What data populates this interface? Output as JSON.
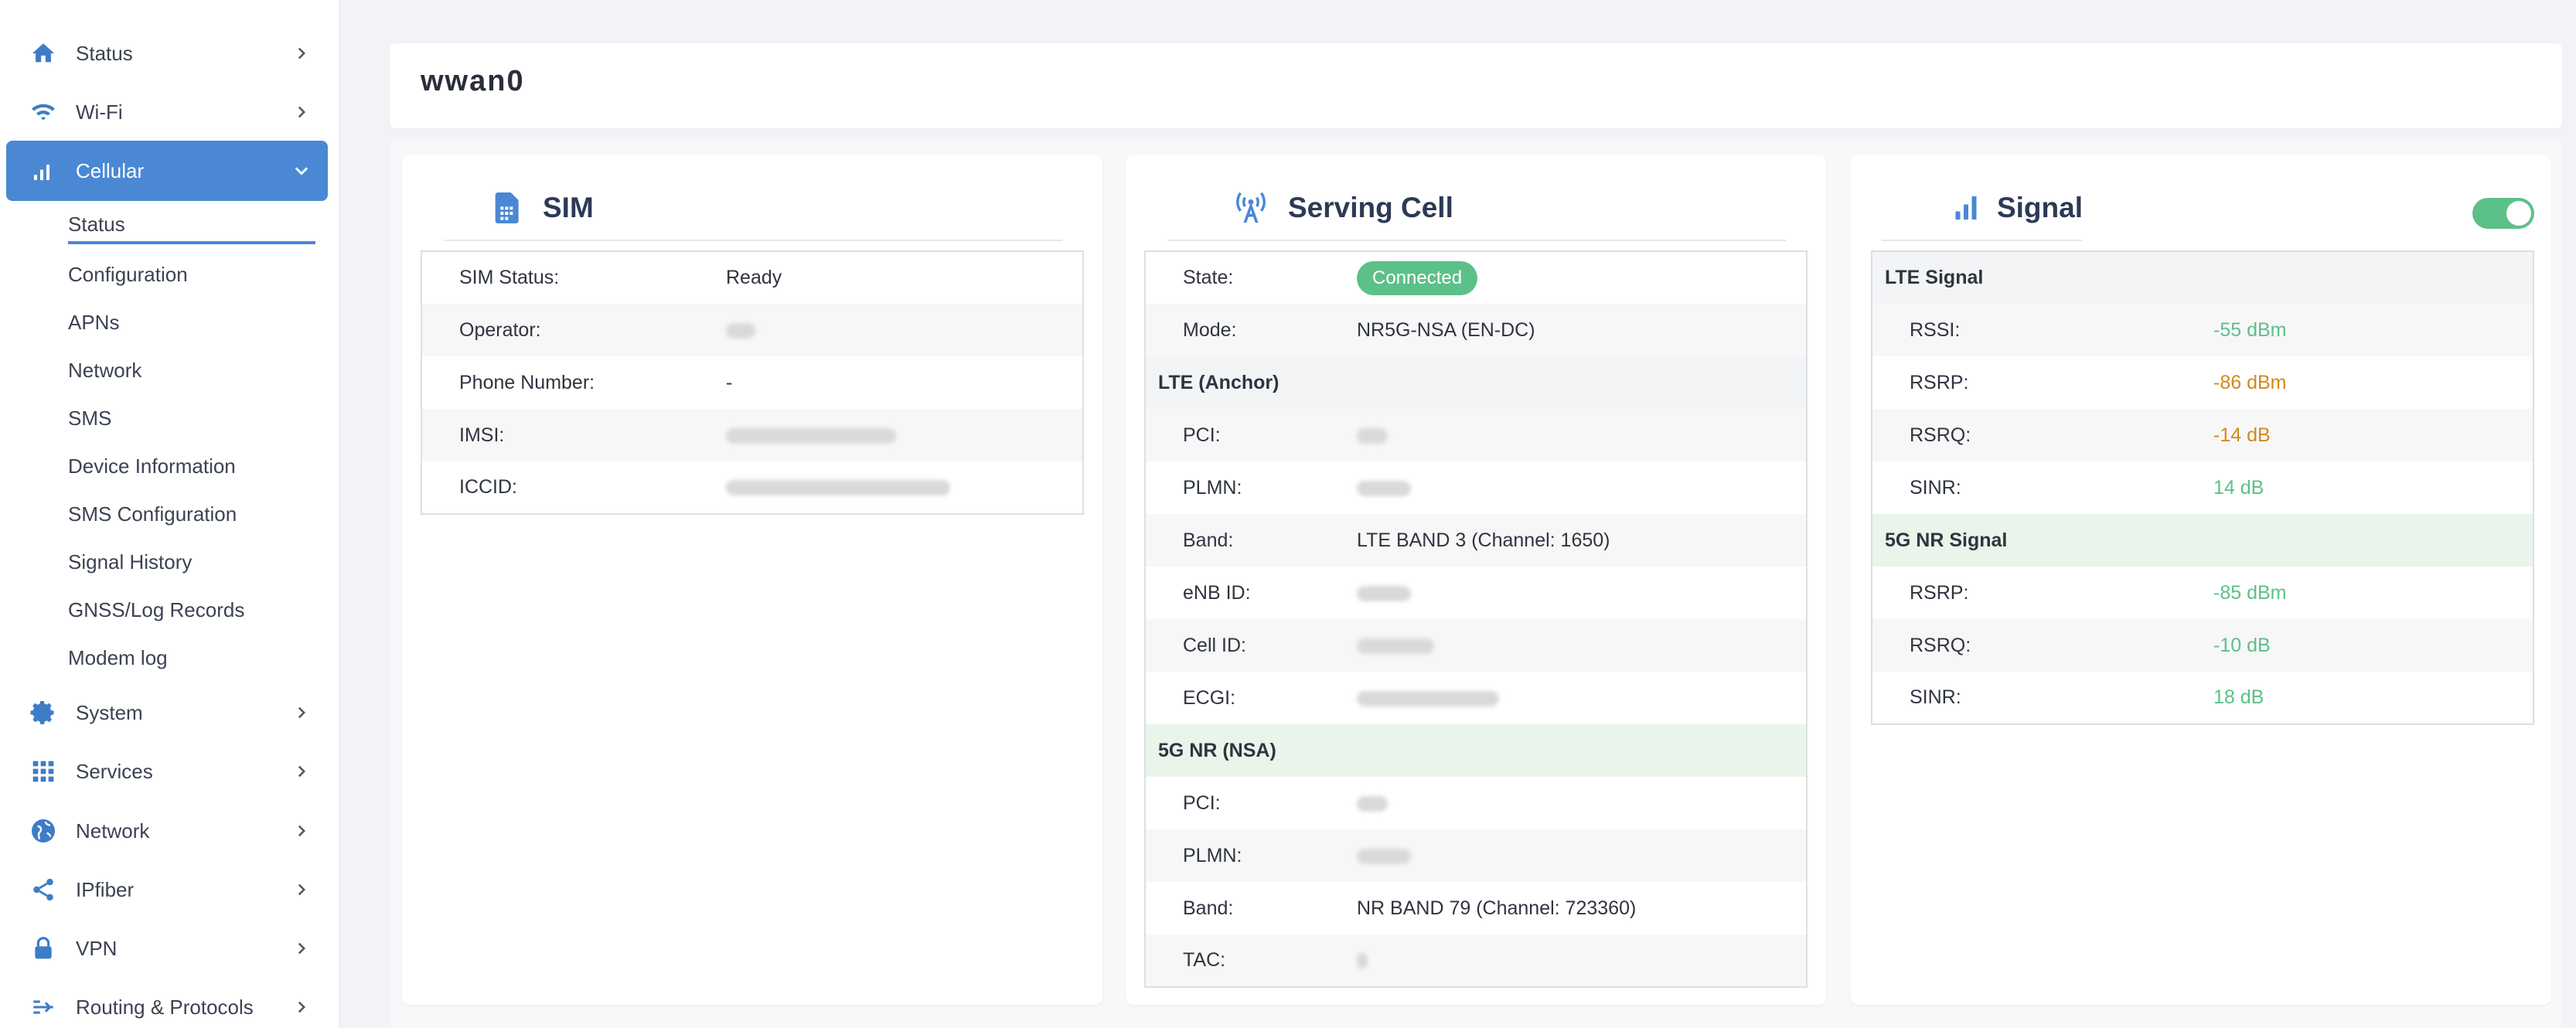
{
  "colors": {
    "accent": "#4a88d4",
    "good": "#5cc089",
    "warn": "#d08a1c"
  },
  "sidebar": {
    "items": [
      {
        "label": "Status",
        "icon": "home-icon"
      },
      {
        "label": "Wi-Fi",
        "icon": "wifi-icon"
      },
      {
        "label": "Cellular",
        "icon": "signal-bars-icon",
        "active": true
      },
      {
        "label": "System",
        "icon": "gear-icon"
      },
      {
        "label": "Services",
        "icon": "grid-icon"
      },
      {
        "label": "Network",
        "icon": "globe-icon"
      },
      {
        "label": "IPfiber",
        "icon": "share-icon"
      },
      {
        "label": "VPN",
        "icon": "lock-icon"
      },
      {
        "label": "Routing & Protocols",
        "icon": "routing-icon"
      }
    ],
    "cellular_sub": [
      {
        "label": "Status",
        "active": true
      },
      {
        "label": "Configuration"
      },
      {
        "label": "APNs"
      },
      {
        "label": "Network"
      },
      {
        "label": "SMS"
      },
      {
        "label": "Device Information"
      },
      {
        "label": "SMS Configuration"
      },
      {
        "label": "Signal History"
      },
      {
        "label": "GNSS/Log Records"
      },
      {
        "label": "Modem log"
      }
    ]
  },
  "page": {
    "title": "wwan0"
  },
  "sim": {
    "title": "SIM",
    "rows": [
      {
        "key": "SIM Status:",
        "value": "Ready"
      },
      {
        "key": "Operator:",
        "value": ""
      },
      {
        "key": "Phone Number:",
        "value": "-"
      },
      {
        "key": "IMSI:",
        "value": ""
      },
      {
        "key": "ICCID:",
        "value": ""
      }
    ]
  },
  "serving_cell": {
    "title": "Serving Cell",
    "state_label": "State:",
    "state_value": "Connected",
    "mode_label": "Mode:",
    "mode_value": "NR5G-NSA (EN-DC)",
    "lte_section": "LTE (Anchor)",
    "lte_rows": [
      {
        "key": "PCI:",
        "value": ""
      },
      {
        "key": "PLMN:",
        "value": ""
      },
      {
        "key": "Band:",
        "value": "LTE BAND 3 (Channel: 1650)"
      },
      {
        "key": "eNB ID:",
        "value": ""
      },
      {
        "key": "Cell ID:",
        "value": ""
      },
      {
        "key": "ECGI:",
        "value": ""
      }
    ],
    "nr_section": "5G NR (NSA)",
    "nr_rows": [
      {
        "key": "PCI:",
        "value": ""
      },
      {
        "key": "PLMN:",
        "value": ""
      },
      {
        "key": "Band:",
        "value": "NR BAND 79 (Channel: 723360)"
      },
      {
        "key": "TAC:",
        "value": ""
      }
    ]
  },
  "signal": {
    "title": "Signal",
    "toggle_on": true,
    "lte_section": "LTE Signal",
    "lte_rows": [
      {
        "key": "RSSI:",
        "value": "-55 dBm",
        "status": "good"
      },
      {
        "key": "RSRP:",
        "value": "-86 dBm",
        "status": "warn"
      },
      {
        "key": "RSRQ:",
        "value": "-14 dB",
        "status": "warn"
      },
      {
        "key": "SINR:",
        "value": "14 dB",
        "status": "good"
      }
    ],
    "nr_section": "5G NR Signal",
    "nr_rows": [
      {
        "key": "RSRP:",
        "value": "-85 dBm",
        "status": "good"
      },
      {
        "key": "RSRQ:",
        "value": "-10 dB",
        "status": "good"
      },
      {
        "key": "SINR:",
        "value": "18 dB",
        "status": "good"
      }
    ]
  }
}
